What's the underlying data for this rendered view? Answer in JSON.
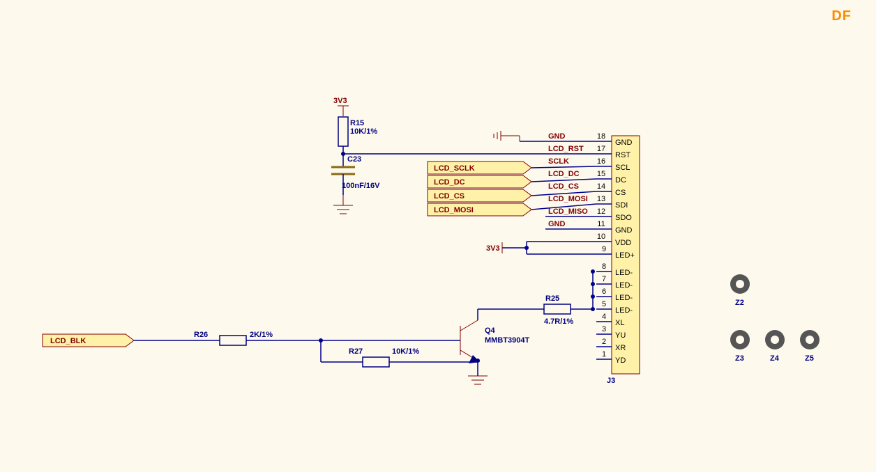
{
  "watermark": "DF",
  "power": {
    "v33a": "3V3",
    "v33b": "3V3"
  },
  "capacitor": {
    "ref": "C23",
    "value": "100nF/16V"
  },
  "resistors": {
    "r15": {
      "ref": "R15",
      "value": "10K/1%"
    },
    "r25": {
      "ref": "R25",
      "value": "4.7R/1%"
    },
    "r26": {
      "ref": "R26",
      "value": "2K/1%"
    },
    "r27": {
      "ref": "R27",
      "value": "10K/1%"
    }
  },
  "transistor": {
    "ref": "Q4",
    "value": "MMBT3904T"
  },
  "netlabels": {
    "lcd_blk": "LCD_BLK",
    "lcd_sclk": "LCD_SCLK",
    "lcd_dc": "LCD_DC",
    "lcd_cs": "LCD_CS",
    "lcd_mosi": "LCD_MOSI"
  },
  "nets": {
    "gnd1": "GND",
    "lcd_rst": "LCD_RST",
    "sclk": "SCLK",
    "lcd_dc2": "LCD_DC",
    "lcd_cs2": "LCD_CS",
    "lcd_mosi2": "LCD_MOSI",
    "lcd_miso": "LCD_MISO",
    "gnd2": "GND"
  },
  "connector": {
    "ref": "J3",
    "pins": {
      "18": "GND",
      "17": "RST",
      "16": "SCL",
      "15": "DC",
      "14": "CS",
      "13": "SDI",
      "12": "SDO",
      "11": "GND",
      "10": "VDD",
      "9": "LED+",
      "8": "LED-",
      "7": "LED-",
      "6": "LED-",
      "5": "LED-",
      "4": "XL",
      "3": "YU",
      "2": "XR",
      "1": "YD"
    }
  },
  "holes": {
    "z2": "Z2",
    "z3": "Z3",
    "z4": "Z4",
    "z5": "Z5"
  }
}
